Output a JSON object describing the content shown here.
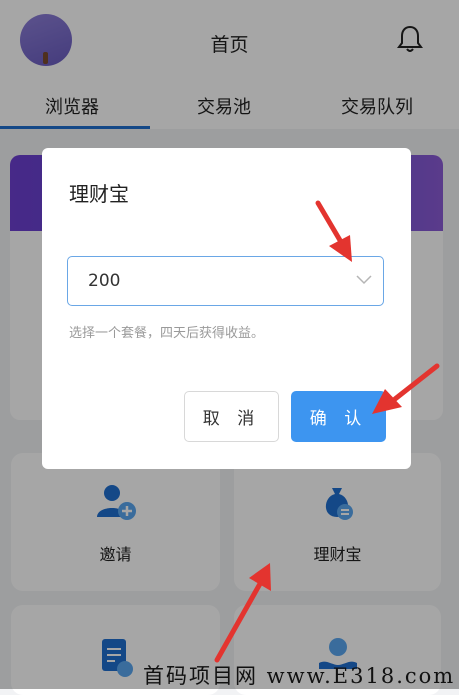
{
  "header": {
    "title": "首页"
  },
  "tabs": [
    "浏览器",
    "交易池",
    "交易队列"
  ],
  "features": [
    {
      "label": "邀请",
      "icon": "invite-user-icon"
    },
    {
      "label": "理财宝",
      "icon": "money-bag-icon"
    },
    {
      "label": "",
      "icon": "document-yuan-icon"
    },
    {
      "label": "",
      "icon": "hand-coin-icon"
    }
  ],
  "dialog": {
    "title": "理财宝",
    "select_value": "200",
    "hint": "选择一个套餐，四天后获得收益。",
    "cancel_label": "取 消",
    "confirm_label": "确 认"
  },
  "watermark": "首码项目网 www.E318.com",
  "colors": {
    "accent": "#3d95f0",
    "arrow": "#e3342f",
    "tab_indicator": "#1f6fd0"
  }
}
